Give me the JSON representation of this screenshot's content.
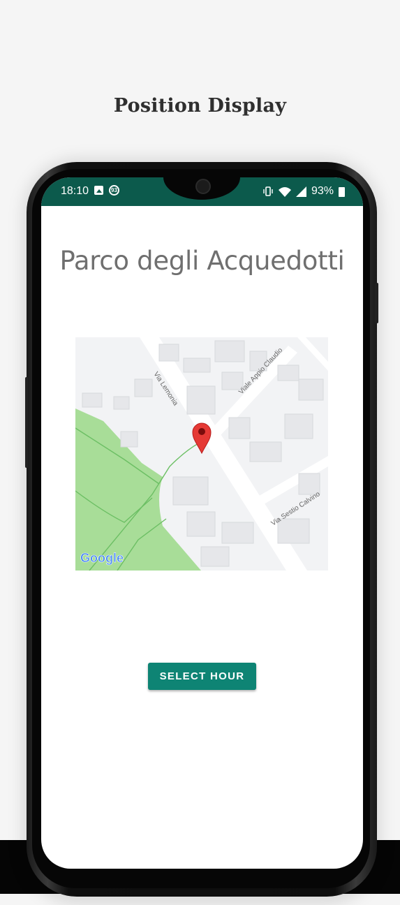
{
  "promo": {
    "title": "Position Display"
  },
  "status_bar": {
    "time": "18:10",
    "notification_badge": "93",
    "battery_percent": "93%",
    "icons": [
      "image-icon",
      "badge-icon",
      "vibrate-icon",
      "wifi-icon",
      "signal-icon",
      "battery-icon"
    ]
  },
  "screen": {
    "place_title": "Parco degli Acquedotti",
    "action_button": "SELECT HOUR"
  },
  "map": {
    "streets": [
      "Via Lemonia",
      "Viale Appio Claudio",
      "Via Sestio Calvino"
    ],
    "attribution": "Google",
    "marker_icon": "map-pin-icon"
  },
  "colors": {
    "status_bar": "#0c5a4c",
    "button": "#0e8474",
    "marker": "#e53935",
    "park": "#a8dd98"
  }
}
